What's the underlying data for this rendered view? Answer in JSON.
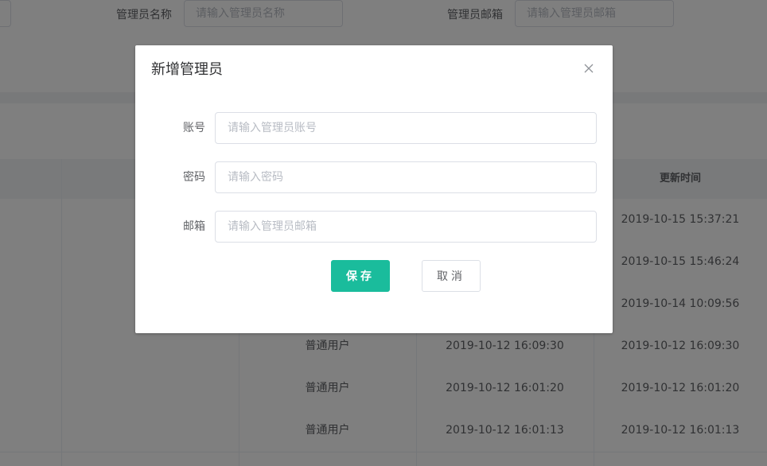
{
  "filters": {
    "admin_name_label": "管理员名称",
    "admin_name_placeholder": "请输入管理员名称",
    "admin_email_label": "管理员邮箱",
    "admin_email_placeholder": "请输入管理员邮箱"
  },
  "table": {
    "headers": [
      "",
      "",
      "",
      "",
      "更新时间"
    ],
    "rows": [
      {
        "role": "",
        "created": "",
        "updated": "2019-10-15 15:37:21"
      },
      {
        "role": "",
        "created": "",
        "updated": "2019-10-15 15:46:24"
      },
      {
        "role": "",
        "created": "",
        "updated": "2019-10-14 10:09:56"
      },
      {
        "role": "普通用户",
        "created": "2019-10-12 16:09:30",
        "updated": "2019-10-12 16:09:30"
      },
      {
        "role": "普通用户",
        "created": "2019-10-12 16:01:20",
        "updated": "2019-10-12 16:01:20"
      },
      {
        "role": "普通用户",
        "created": "2019-10-12 16:01:13",
        "updated": "2019-10-12 16:01:13"
      }
    ]
  },
  "dialog": {
    "title": "新增管理员",
    "close_icon": "close-icon",
    "fields": {
      "account": {
        "label": "账号",
        "placeholder": "请输入管理员账号",
        "value": ""
      },
      "password": {
        "label": "密码",
        "placeholder": "请输入密码",
        "value": ""
      },
      "email": {
        "label": "邮箱",
        "placeholder": "请输入管理员邮箱",
        "value": ""
      }
    },
    "save_label": "保存",
    "cancel_label": "取消"
  },
  "colors": {
    "primary": "#1abc9c",
    "overlay": "rgba(0,0,0,0.5)"
  }
}
